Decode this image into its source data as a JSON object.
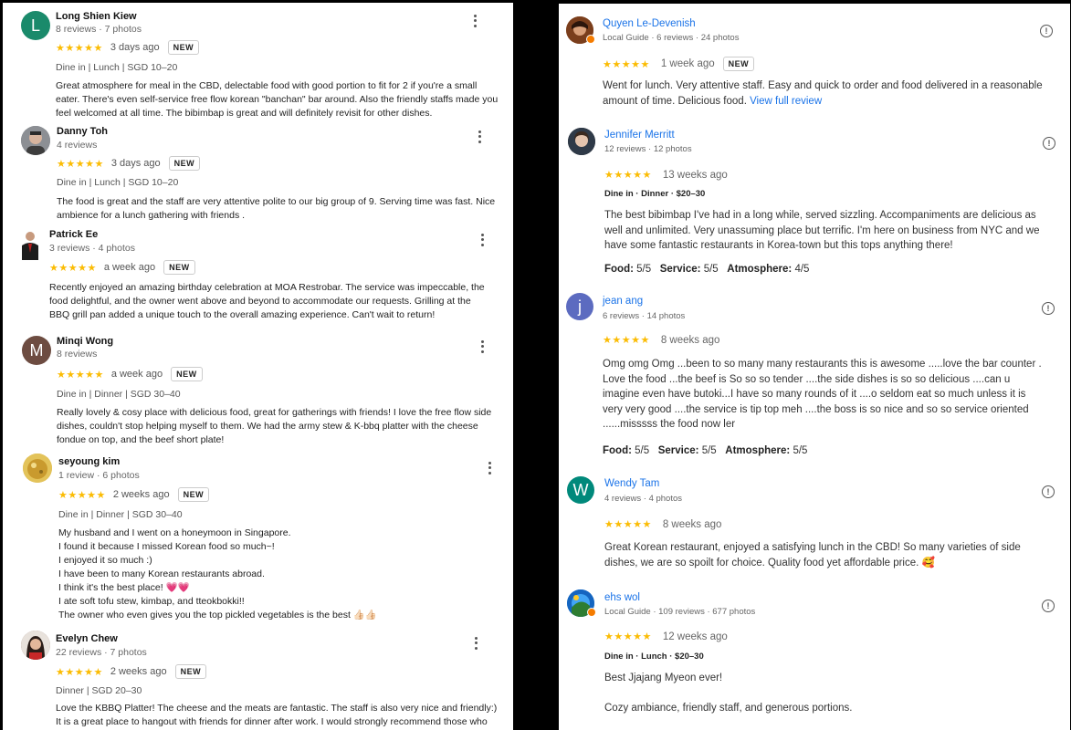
{
  "left": {
    "reviews": [
      {
        "avatar_letter": "L",
        "avatar_color": "#1a8a6b",
        "name": "Long Shien Kiew",
        "meta": "8 reviews · 7 photos",
        "stars": "★★★★★",
        "time": "3 days ago",
        "badge": "NEW",
        "tags": "Dine in  |  Lunch  |  SGD 10–20",
        "lines": [
          "Great atmosphere for meal in the CBD, delectable food with good portion to fit for 2 if you're a small",
          "eater. There's even self-service free flow korean \"banchan\" bar around. Also the friendly staffs made you",
          "feel welcomed at all time. The bibimbap is great and will definitely revisit for other dishes."
        ]
      },
      {
        "avatar_icon": "photo-avatar",
        "name": "Danny Toh",
        "meta": "4 reviews",
        "stars": "★★★★★",
        "time": "3 days ago",
        "badge": "NEW",
        "tags": "Dine in  |  Lunch  |  SGD 10–20",
        "lines": [
          "The food is great and the staff are very attentive polite to our big group of 9. Serving time was fast. Nice",
          "ambience for a lunch gathering with friends ."
        ]
      },
      {
        "avatar_icon": "photo-avatar",
        "name": "Patrick Ee",
        "meta": "3 reviews · 4 photos",
        "stars": "★★★★★",
        "time": "a week ago",
        "badge": "NEW",
        "lines": [
          "Recently enjoyed an amazing birthday celebration at MOA Restrobar. The service was impeccable, the",
          "food delightful, and the owner went above and beyond to accommodate our requests. Grilling at the",
          "BBQ grill pan added a unique touch to the overall amazing experience. Can't wait to return!"
        ]
      },
      {
        "avatar_letter": "M",
        "avatar_color": "#6d4c41",
        "name": "Minqi Wong",
        "meta": "8 reviews",
        "stars": "★★★★★",
        "time": "a week ago",
        "badge": "NEW",
        "tags": "Dine in  |  Dinner  |  SGD 30–40",
        "lines": [
          "Really lovely & cosy place with delicious food, great for gatherings with friends! I love the free flow side",
          "dishes, couldn't stop helping myself to them. We had the army stew & K-bbq platter with the cheese",
          "fondue on top, and the beef short plate!"
        ]
      },
      {
        "avatar_icon": "photo-avatar",
        "name": "seyoung kim",
        "meta": "1 review · 6 photos",
        "stars": "★★★★★",
        "time": "2 weeks ago",
        "badge": "NEW",
        "tags": "Dine in  |  Dinner  |  SGD 30–40",
        "lines": [
          "My husband and I went on a honeymoon in Singapore.",
          "I found it because I missed Korean food so much~!",
          "I enjoyed it so much :)",
          "I have been to many Korean restaurants abroad.",
          "I think it's the best place! 💗💗",
          "I ate soft tofu stew, kimbap, and tteokbokki!!",
          "The owner who even gives you the top pickled vegetables is the best 👍🏻👍🏻"
        ]
      },
      {
        "avatar_icon": "photo-avatar",
        "name": "Evelyn Chew",
        "meta": "22 reviews · 7 photos",
        "stars": "★★★★★",
        "time": "2 weeks ago",
        "badge": "NEW",
        "tags": "Dinner  |  SGD 20–30",
        "lines": [
          "Love the KBBQ Platter! The cheese and the meats are fantastic. The staff is also very nice and friendly:)",
          "It is a great place to hangout with friends for dinner after work. I would strongly recommend those who"
        ]
      }
    ]
  },
  "right": {
    "reviews": [
      {
        "avatar_icon": "photo-avatar",
        "name": "Quyen Le-Devenish",
        "meta": "Local Guide · 6 reviews · 24 photos",
        "stars": "★★★★★",
        "time": "1 week ago",
        "badge": "NEW",
        "lines": [
          "Went for lunch. Very attentive staff. Easy and quick to order and food delivered in a reasonable",
          "amount of time. Delicious food."
        ],
        "link": "View full review"
      },
      {
        "avatar_icon": "photo-avatar",
        "name": "Jennifer Merritt",
        "meta": "12 reviews · 12 photos",
        "stars": "★★★★★",
        "time": "13 weeks ago",
        "tags": "Dine in · Dinner · $20–30",
        "lines": [
          "The best bibimbap I've had in a long while, served sizzling. Accompaniments are delicious as",
          "well and unlimited. Very unassuming place but terrific. I'm here on business from NYC and we",
          "have some fantastic restaurants in Korea-town but this tops anything there!"
        ],
        "scores": {
          "food_label": "Food:",
          "food": "5/5",
          "service_label": "Service:",
          "service": "5/5",
          "atmosphere_label": "Atmosphere:",
          "atmosphere": "4/5"
        }
      },
      {
        "avatar_letter": "j",
        "avatar_color": "#5c6bc0",
        "name": "jean ang",
        "meta": "6 reviews · 14 photos",
        "stars": "★★★★★",
        "time": "8 weeks ago",
        "lines": [
          "Omg omg Omg ...been to so many many restaurants this is awesome .....love the bar counter .",
          "Love the food ...the beef is So so so tender ....the side dishes is so so delicious ....can u",
          "imagine even have butoki...I have so many rounds of it ....o seldom eat so much unless it is",
          "very very good ....the service is tip top meh ....the boss is so nice and so so service oriented",
          "......misssss the food now ler"
        ],
        "scores": {
          "food_label": "Food:",
          "food": "5/5",
          "service_label": "Service:",
          "service": "5/5",
          "atmosphere_label": "Atmosphere:",
          "atmosphere": "5/5"
        }
      },
      {
        "avatar_letter": "W",
        "avatar_color": "#00897b",
        "name": "Wendy Tam",
        "meta": "4 reviews · 4 photos",
        "stars": "★★★★★",
        "time": "8 weeks ago",
        "lines": [
          "Great Korean restaurant, enjoyed a satisfying lunch in the CBD! So many varieties of side",
          "dishes, we are so spoilt for choice. Quality food yet affordable price. 🥰"
        ]
      },
      {
        "avatar_icon": "photo-avatar",
        "name": "ehs wol",
        "meta": "Local Guide · 109 reviews · 677 photos",
        "stars": "★★★★★",
        "time": "12 weeks ago",
        "tags": "Dine in · Lunch · $20–30",
        "lines": [
          "Best Jjajang Myeon ever!",
          "",
          "Cozy ambiance, friendly staff, and generous portions."
        ]
      }
    ]
  }
}
